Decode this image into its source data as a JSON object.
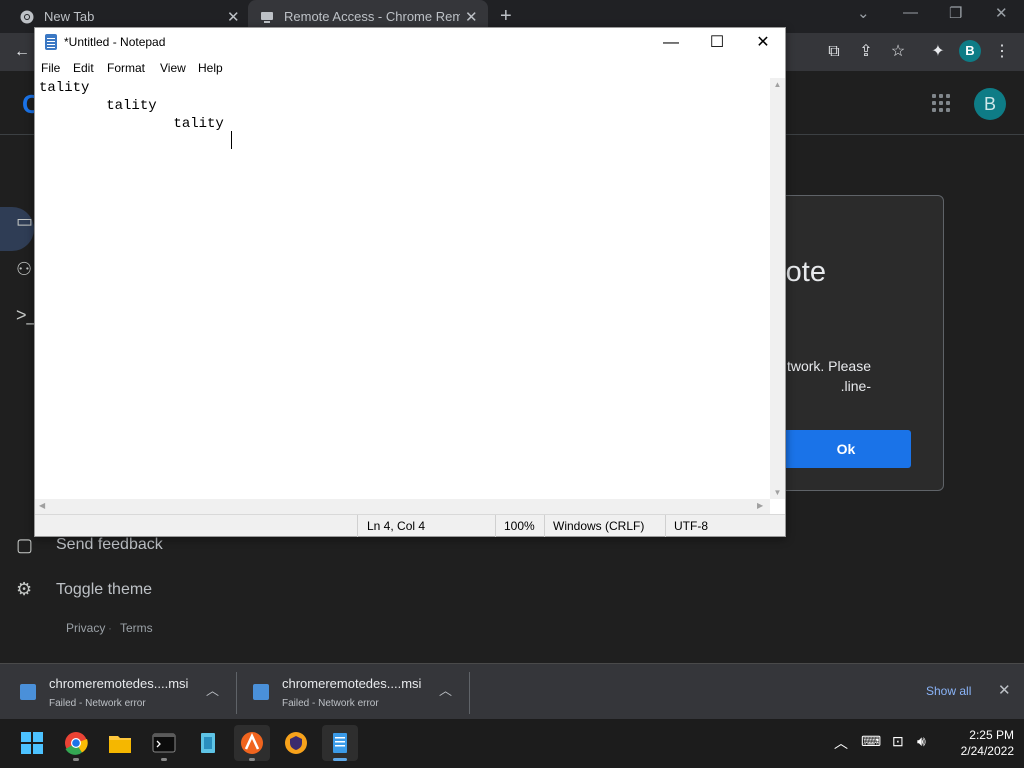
{
  "chrome": {
    "tabs": [
      {
        "title": "New Tab",
        "active": false
      },
      {
        "title": "Remote Access - Chrome Remote Desktop",
        "active": true
      }
    ],
    "profile_initial": "B"
  },
  "page": {
    "avatar_initial": "B",
    "sidebar": {
      "send_feedback": "Send feedback",
      "toggle_theme": "Toggle theme",
      "privacy": "Privacy",
      "terms": "Terms"
    },
    "dialog": {
      "title_fragment": "ote",
      "message_line1": "twork. Please",
      "message_line2": "-line.",
      "ok_label": "Ok"
    }
  },
  "notepad": {
    "title": "*Untitled - Notepad",
    "menu": [
      "File",
      "Edit",
      "Format",
      "View",
      "Help"
    ],
    "lines": [
      "tality",
      "        tality",
      "                tality"
    ],
    "status": {
      "position": "Ln 4, Col 4",
      "zoom": "100%",
      "line_ending": "Windows (CRLF)",
      "encoding": "UTF-8"
    }
  },
  "downloads": {
    "items": [
      {
        "filename": "chromeremotedes....msi",
        "status": "Failed - Network error"
      },
      {
        "filename": "chromeremotedes....msi",
        "status": "Failed - Network error"
      }
    ],
    "show_all": "Show all"
  },
  "taskbar": {
    "time": "2:25 PM",
    "date": "2/24/2022"
  },
  "colors": {
    "chrome_dark": "#202124",
    "accent_blue": "#1a73e8",
    "profile_teal": "#0e7c86"
  }
}
